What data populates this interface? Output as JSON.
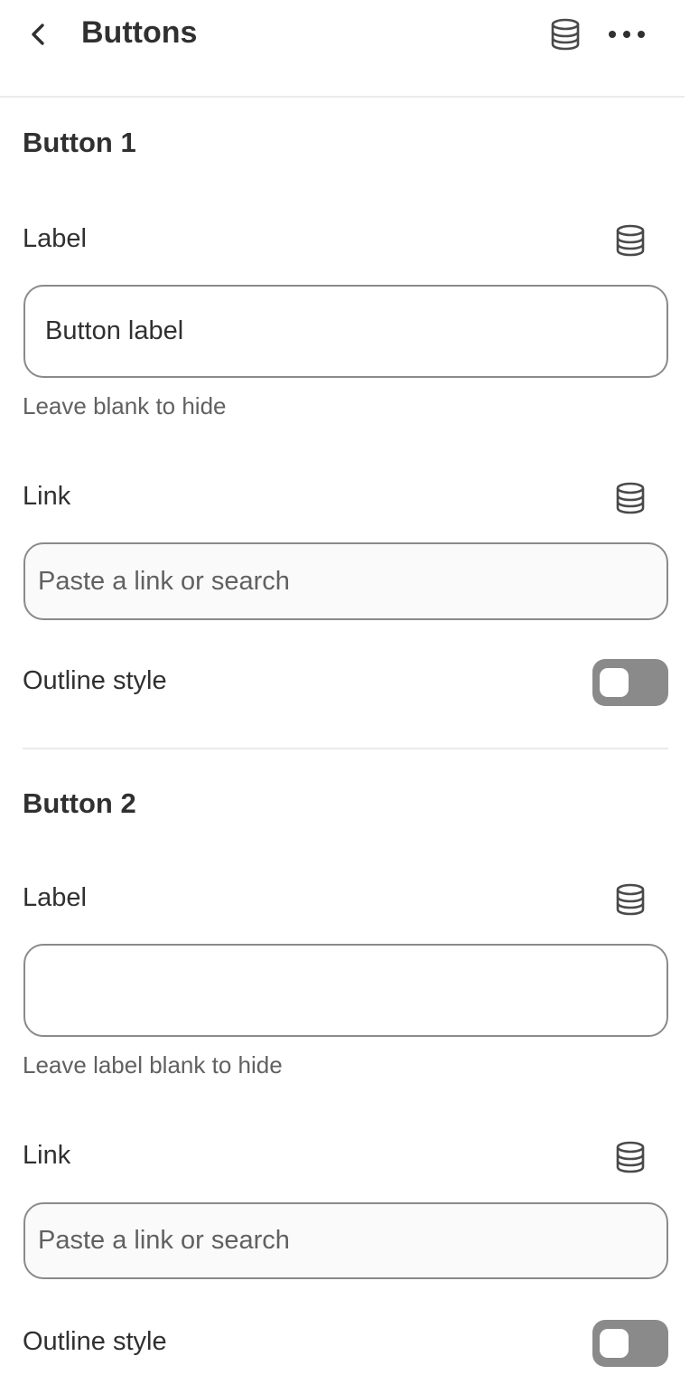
{
  "header": {
    "title": "Buttons",
    "back_icon": "chevron-left-icon",
    "db_icon": "database-icon",
    "more_icon": "ellipsis-horizontal-icon"
  },
  "button1": {
    "title": "Button 1",
    "label_field": {
      "label": "Label",
      "value": "Button label",
      "help": "Leave blank to hide"
    },
    "link_field": {
      "label": "Link",
      "placeholder": "Paste a link or search",
      "value": ""
    },
    "outline": {
      "label": "Outline style",
      "checked": false
    }
  },
  "button2": {
    "title": "Button 2",
    "label_field": {
      "label": "Label",
      "value": "",
      "help": "Leave label blank to hide"
    },
    "link_field": {
      "label": "Link",
      "placeholder": "Paste a link or search",
      "value": ""
    },
    "outline": {
      "label": "Outline style",
      "checked": false
    }
  },
  "colors": {
    "text": "#303030",
    "muted_text": "#616161",
    "border": "#8a8a8a",
    "toggle_off": "#8a8a8a",
    "divider": "#ebebeb"
  }
}
